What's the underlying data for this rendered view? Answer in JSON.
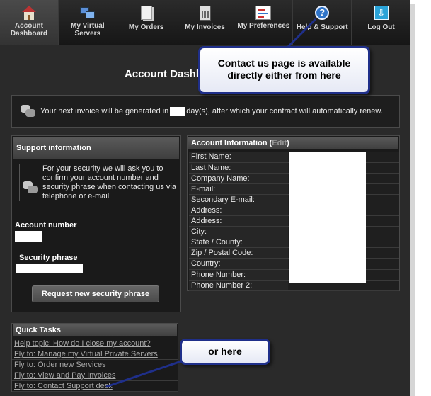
{
  "nav": {
    "items": [
      {
        "label": "Account\nDashboard",
        "icon": "home-icon",
        "active": true
      },
      {
        "label": "My Virtual\nServers",
        "icon": "servers-icon",
        "active": false
      },
      {
        "label": "My Orders",
        "icon": "orders-icon",
        "active": false
      },
      {
        "label": "My Invoices",
        "icon": "calculator-icon",
        "active": false
      },
      {
        "label": "My Preferences",
        "icon": "preferences-icon",
        "active": false
      },
      {
        "label": "Help & Support",
        "icon": "help-icon",
        "active": false
      },
      {
        "label": "Log Out",
        "icon": "logout-icon",
        "active": false
      }
    ]
  },
  "page": {
    "title": "Account Dashb"
  },
  "notice": {
    "text_before": "Your next invoice will be generated in",
    "text_after": "day(s), after which your contract will automatically renew."
  },
  "support": {
    "header": "Support information",
    "note": "For your security we will ask you to confirm your account number and security phrase when contacting us via telephone or e-mail",
    "account_number_label": "Account number",
    "security_phrase_label": "Security phrase",
    "request_button": "Request new security phrase"
  },
  "account": {
    "header_prefix": "Account Information (",
    "edit_label": "Edit",
    "header_suffix": ")",
    "fields": [
      "First Name:",
      "Last Name:",
      "Company Name:",
      "E-mail:",
      "Secondary E-mail:",
      "Address:",
      "Address:",
      "City:",
      "State / County:",
      "Zip / Postal Code:",
      "Country:",
      "Phone Number:",
      "Phone Number 2:"
    ]
  },
  "quick_tasks": {
    "header": "Quick Tasks",
    "links": [
      "Help topic: How do I close my account?",
      "Fly to: Manage my Virtual Private Servers",
      "Fly to: Order new Services",
      "Fly to: View and Pay Invoices",
      "Fly to: Contact Support desk"
    ]
  },
  "callouts": {
    "top": "Contact us page is available directly either from here",
    "bottom": "or here"
  },
  "colors": {
    "background": "#2a2a2a",
    "nav_bar": "#1b1b1b",
    "callout_border": "#1f2f8a",
    "link": "#a8a8a8"
  }
}
